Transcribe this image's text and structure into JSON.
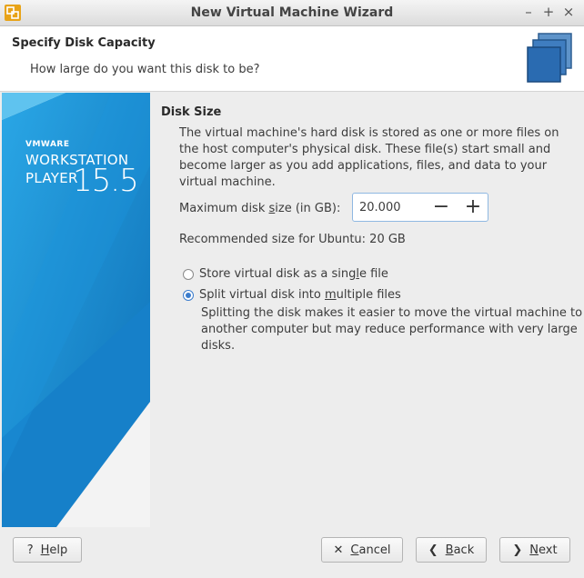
{
  "window": {
    "title": "New Virtual Machine Wizard",
    "minimize_glyph": "–",
    "maximize_glyph": "+",
    "close_glyph": "×"
  },
  "header": {
    "title": "Specify Disk Capacity",
    "subtitle": "How large do you want this disk to be?"
  },
  "brand": {
    "vendor": "VMWARE",
    "product_line1": "WORKSTATION",
    "product_line2": "PLAYER",
    "version": "15.5"
  },
  "disk": {
    "section_title": "Disk Size",
    "description": "The virtual machine's hard disk is stored as one or more files on the host computer's physical disk. These file(s) start small and become larger as you add applications, files, and data to your virtual machine.",
    "max_size_label_pre": "Maximum disk ",
    "max_size_label_mnemonic": "s",
    "max_size_label_post": "ize (in GB):",
    "max_size_value": "20.000",
    "recommended": "Recommended size for Ubuntu: 20 GB"
  },
  "options": {
    "single_pre": "Store virtual disk as a sing",
    "single_mnemonic": "l",
    "single_post": "e file",
    "single_checked": false,
    "multi_pre": "Split virtual disk into ",
    "multi_mnemonic": "m",
    "multi_post": "ultiple files",
    "multi_checked": true,
    "multi_description": "Splitting the disk makes it easier to move the virtual machine to another computer but may reduce performance with very large disks."
  },
  "buttons": {
    "help_mnemonic": "H",
    "help_rest": "elp",
    "cancel_mnemonic": "C",
    "cancel_rest": "ancel",
    "back_mnemonic": "B",
    "back_rest": "ack",
    "next_mnemonic": "N",
    "next_rest": "ext"
  },
  "colors": {
    "brand_blue": "#1a8fd8",
    "radio_accent": "#3b7ccc"
  }
}
